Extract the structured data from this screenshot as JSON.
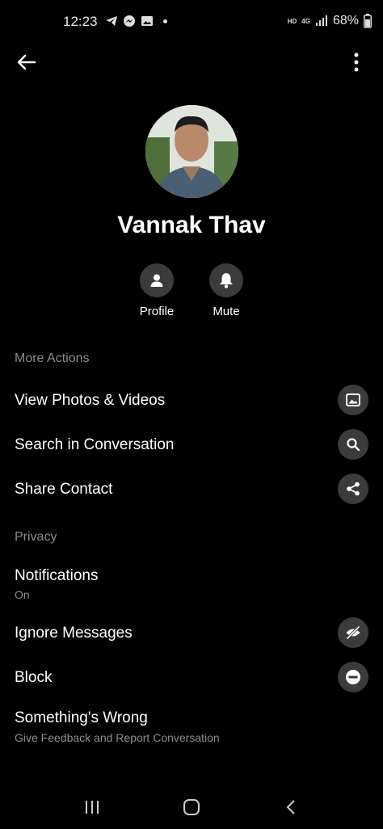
{
  "status": {
    "time": "12:23",
    "hd": "HD",
    "network": "4G",
    "battery": "68%"
  },
  "profile": {
    "name": "Vannak Thav"
  },
  "quick_actions": [
    {
      "label": "Profile"
    },
    {
      "label": "Mute"
    }
  ],
  "sections": {
    "more_actions": "More Actions",
    "privacy": "Privacy"
  },
  "rows": {
    "photos": "View Photos & Videos",
    "search": "Search in Conversation",
    "share": "Share Contact",
    "notifications": {
      "title": "Notifications",
      "sub": "On"
    },
    "ignore": "Ignore Messages",
    "block": "Block",
    "wrong": {
      "title": "Something's Wrong",
      "sub": "Give Feedback and Report Conversation"
    }
  },
  "icons": {
    "back": "back-arrow-icon",
    "more": "more-vertical-icon",
    "profile": "person-icon",
    "mute": "bell-icon",
    "photos": "image-icon",
    "search": "search-icon",
    "share": "share-icon",
    "ignore": "eye-off-icon",
    "block": "block-icon"
  },
  "colors": {
    "background": "#000000",
    "icon_bg": "#3a3b3c",
    "muted_text": "#8a8d91"
  }
}
